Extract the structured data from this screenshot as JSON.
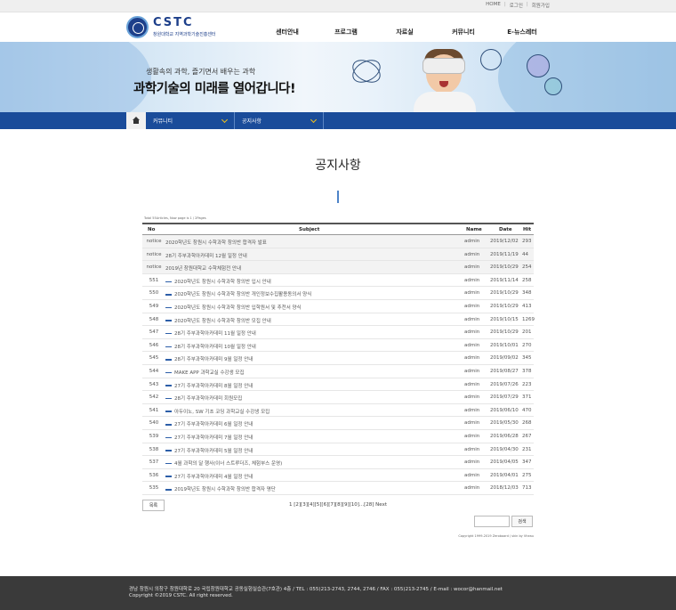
{
  "util": {
    "home": "HOME",
    "login": "로그인",
    "join": "회원가입"
  },
  "logo": {
    "title": "CSTC",
    "sub": "창원대학교 지역과학기술진흥센터"
  },
  "gnb": [
    "센터안내",
    "프로그램",
    "자료실",
    "커뮤니티",
    "E-뉴스레터"
  ],
  "banner": {
    "sub": "생활속의 과학, 즐기면서 배우는 과학",
    "main": "과학기술의 미래를 열어갑니다!"
  },
  "subnav": {
    "menu1": "커뮤니티",
    "menu2": "공지사항"
  },
  "page_title": "공지사항",
  "board": {
    "total": "Total 55Articles, Now page is 1 / 2Pages",
    "headers": {
      "no": "No",
      "subject": "Subject",
      "name": "Name",
      "date": "Date",
      "hit": "Hit"
    },
    "rows": [
      {
        "no": "notice",
        "subject": "2020학년도 창원시 수학과학 창의반 합격자 발표",
        "name": "admin",
        "date": "2019/12/02",
        "hit": "293"
      },
      {
        "no": "notice",
        "subject": "28기 주부과학아카데미 12월 일정 안내",
        "name": "admin",
        "date": "2019/11/19",
        "hit": "44"
      },
      {
        "no": "notice",
        "subject": "2019년 창원대학교 수학체험전 안내",
        "name": "admin",
        "date": "2019/10/29",
        "hit": "254"
      },
      {
        "no": "551",
        "subject": "2020학년도 창원시 수학과학 창의반 입시 안내",
        "name": "admin",
        "date": "2019/11/14",
        "hit": "258"
      },
      {
        "no": "550",
        "subject": "2020학년도 창원시 수학과학 창의반 개인정보수집활용동의서 양식",
        "name": "admin",
        "date": "2019/10/29",
        "hit": "348"
      },
      {
        "no": "549",
        "subject": "2020학년도 창원시 수학과학 창의반 입학원서 및 추천서 양식",
        "name": "admin",
        "date": "2019/10/29",
        "hit": "413"
      },
      {
        "no": "548",
        "subject": "2020학년도 창원시 수학과학 창의반 모집 안내",
        "name": "admin",
        "date": "2019/10/15",
        "hit": "1269"
      },
      {
        "no": "547",
        "subject": "28기 주부과학아카데미 11월 일정 안내",
        "name": "admin",
        "date": "2019/10/29",
        "hit": "201"
      },
      {
        "no": "546",
        "subject": "28기 주부과학아카데미 10월 일정 안내",
        "name": "admin",
        "date": "2019/10/01",
        "hit": "270"
      },
      {
        "no": "545",
        "subject": "28기 주부과학아카데미 9월 일정 안내",
        "name": "admin",
        "date": "2019/09/02",
        "hit": "345"
      },
      {
        "no": "544",
        "subject": "MAKE APP 과학교실 수강생 모집",
        "name": "admin",
        "date": "2019/08/27",
        "hit": "378"
      },
      {
        "no": "543",
        "subject": "27기 주부과학아카데미 8월 일정 안내",
        "name": "admin",
        "date": "2019/07/26",
        "hit": "223"
      },
      {
        "no": "542",
        "subject": "28기 주부과학아카데미 회원모집",
        "name": "admin",
        "date": "2019/07/29",
        "hit": "371"
      },
      {
        "no": "541",
        "subject": "아두이노, SW 기초 코딩 과학교실 수강생 모집",
        "name": "admin",
        "date": "2019/06/10",
        "hit": "470"
      },
      {
        "no": "540",
        "subject": "27기 주부과학아카데미 6월 일정 안내",
        "name": "admin",
        "date": "2019/05/30",
        "hit": "268"
      },
      {
        "no": "539",
        "subject": "27기 주부과학아카데미 7월 일정 안내",
        "name": "admin",
        "date": "2019/06/28",
        "hit": "267"
      },
      {
        "no": "538",
        "subject": "27기 주부과학아카데미 5월 일정 안내",
        "name": "admin",
        "date": "2019/04/30",
        "hit": "231"
      },
      {
        "no": "537",
        "subject": "4월 과학의 달 행사(이너 스트루더즈, 체험부스 운영)",
        "name": "admin",
        "date": "2019/04/05",
        "hit": "347"
      },
      {
        "no": "536",
        "subject": "27기 주부과학아카데미 4월 일정 안내",
        "name": "admin",
        "date": "2019/04/01",
        "hit": "275"
      },
      {
        "no": "535",
        "subject": "2019학년도 창원시 수학과학 창의반 합격자 명단",
        "name": "admin",
        "date": "2018/12/03",
        "hit": "713"
      }
    ]
  },
  "list_button": "목록",
  "pagination": "1 [2][3][4][5][6][7][8][9][10]...[28] Next",
  "search_button": "검색",
  "search_value": "",
  "copy_small": "Copyright 1999-2019 Zeroboard / skin by Vheau",
  "footer": {
    "address": "경남 창원시 의창구 창원대학로 20 국립창원대학교 공동실험실습관(7호관) 4층 / TEL : 055)213-2743, 2744, 2746 / FAX : 055)213-2745 / E-mail : wocor@hanmail.net",
    "copyright": "Copyright ©2019 CSTC. All right reserved."
  },
  "colors": {
    "accent": "#1a4c9a",
    "footer_bg": "#3a3a3a"
  }
}
